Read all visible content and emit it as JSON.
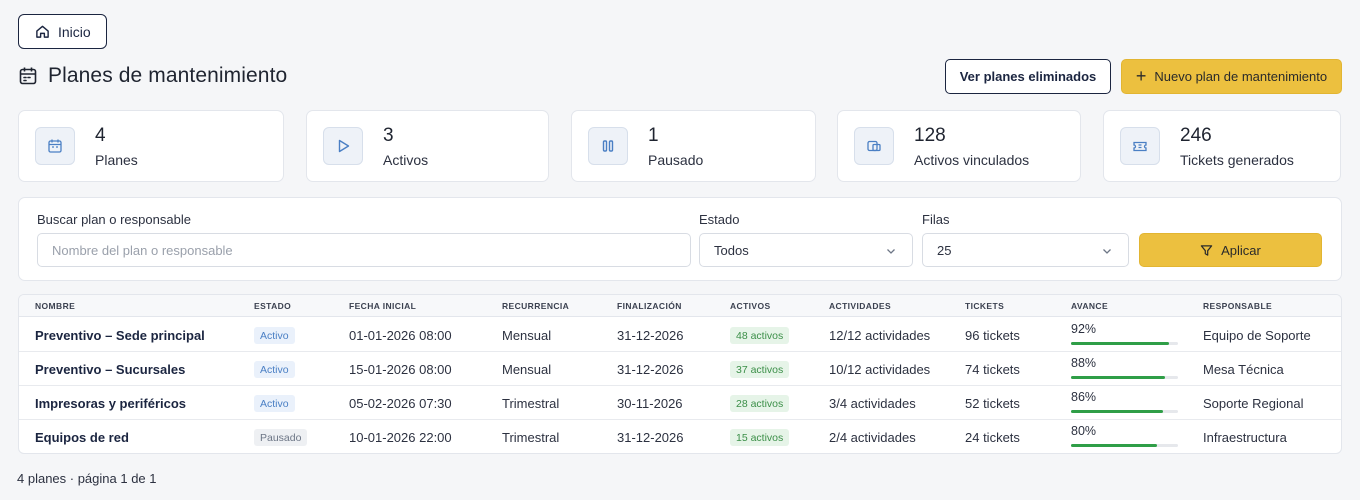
{
  "nav": {
    "home_label": "Inicio"
  },
  "header": {
    "title": "Planes de mantenimiento",
    "deleted_button": "Ver planes eliminados",
    "new_button": "Nuevo plan de mantenimiento"
  },
  "stats": [
    {
      "value": "4",
      "label": "Planes",
      "icon": "calendar-icon"
    },
    {
      "value": "3",
      "label": "Activos",
      "icon": "play-icon"
    },
    {
      "value": "1",
      "label": "Pausado",
      "icon": "pause-icon"
    },
    {
      "value": "128",
      "label": "Activos vinculados",
      "icon": "linked-devices-icon"
    },
    {
      "value": "246",
      "label": "Tickets generados",
      "icon": "ticket-icon"
    }
  ],
  "filters": {
    "search_label": "Buscar plan o responsable",
    "search_placeholder": "Nombre del plan o responsable",
    "status_label": "Estado",
    "status_value": "Todos",
    "rows_label": "Filas",
    "rows_value": "25",
    "apply_button": "Aplicar"
  },
  "table": {
    "columns": [
      "NOMBRE",
      "ESTADO",
      "FECHA INICIAL",
      "RECURRENCIA",
      "FINALIZACIÓN",
      "ACTIVOS",
      "ACTIVIDADES",
      "TICKETS",
      "AVANCE",
      "RESPONSABLE"
    ],
    "rows": [
      {
        "name": "Preventivo – Sede principal",
        "status": "Activo",
        "start": "01-01-2026 08:00",
        "recurrence": "Mensual",
        "end": "31-12-2026",
        "assets": "48 activos",
        "activities": "12/12 actividades",
        "tickets": "96 tickets",
        "progress_label": "92%",
        "progress": 0.92,
        "owner": "Equipo de Soporte"
      },
      {
        "name": "Preventivo – Sucursales",
        "status": "Activo",
        "start": "15-01-2026 08:00",
        "recurrence": "Mensual",
        "end": "31-12-2026",
        "assets": "37 activos",
        "activities": "10/12 actividades",
        "tickets": "74 tickets",
        "progress_label": "88%",
        "progress": 0.88,
        "owner": "Mesa Técnica"
      },
      {
        "name": "Impresoras y periféricos",
        "status": "Activo",
        "start": "05-02-2026 07:30",
        "recurrence": "Trimestral",
        "end": "30-11-2026",
        "assets": "28 activos",
        "activities": "3/4 actividades",
        "tickets": "52 tickets",
        "progress_label": "86%",
        "progress": 0.86,
        "owner": "Soporte Regional"
      },
      {
        "name": "Equipos de red",
        "status": "Pausado",
        "start": "10-01-2026 22:00",
        "recurrence": "Trimestral",
        "end": "31-12-2026",
        "assets": "15 activos",
        "activities": "2/4 actividades",
        "tickets": "24 tickets",
        "progress_label": "80%",
        "progress": 0.8,
        "owner": "Infraestructura"
      }
    ]
  },
  "footer": {
    "pagination_text": "4 planes · página 1 de 1"
  },
  "colors": {
    "accent": "#ecc03f",
    "navy": "#1b2540",
    "progress": "#2f9e47",
    "status_active": "#4a7fc4",
    "assets_badge": "#3b8f48"
  }
}
